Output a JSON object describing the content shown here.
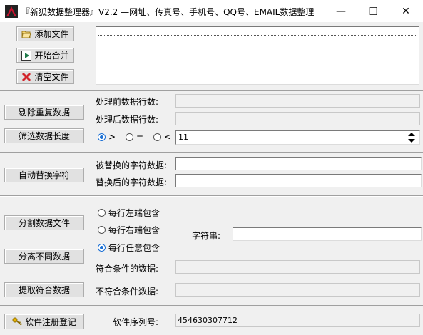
{
  "window": {
    "title": "『新狐数据整理器』V2.2 —网址、传真号、手机号、QQ号、EMAIL数据整理",
    "minimize": "—",
    "maximize": "☐",
    "close": "✕"
  },
  "files": {
    "add_label": "添加文件",
    "merge_label": "开始合并",
    "clear_label": "清空文件"
  },
  "dedupe": {
    "button": "剔除重复数据",
    "before_label": "处理前数据行数:",
    "after_label": "处理后数据行数:",
    "before_value": "",
    "after_value": ""
  },
  "length_filter": {
    "button": "筛选数据长度",
    "opt_gt": ">",
    "opt_eq": "=",
    "opt_lt": "<",
    "selected": ">",
    "value": "11"
  },
  "replace": {
    "button": "自动替换字符",
    "from_label": "被替换的字符数据:",
    "to_label": "替换后的字符数据:",
    "from_value": "",
    "to_value": ""
  },
  "split": {
    "split_button": "分割数据文件",
    "separate_button": "分离不同数据",
    "extract_button": "提取符合数据",
    "opt_left": "每行左端包含",
    "opt_right": "每行右端包含",
    "opt_any": "每行任意包含",
    "selected": "每行任意包含",
    "string_label": "字符串:",
    "string_value": "",
    "match_label": "符合条件的数据:",
    "nomatch_label": "不符合条件数据:"
  },
  "register": {
    "button": "软件注册登记",
    "serial_label": "软件序列号:",
    "serial_value": "454630307712"
  }
}
